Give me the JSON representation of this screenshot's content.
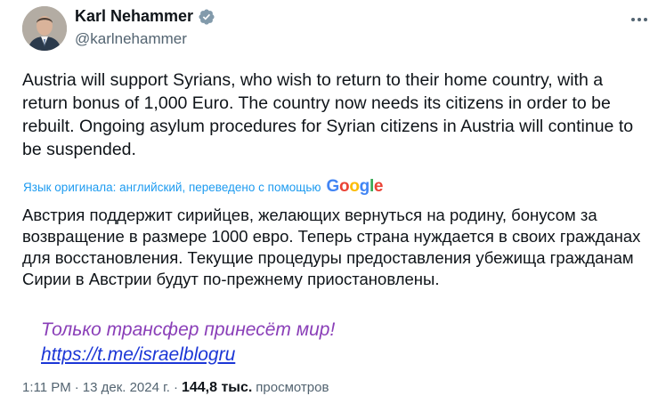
{
  "author": {
    "display_name": "Karl Nehammer",
    "handle": "@karlnehammer",
    "verified_icon": "verified-badge-icon"
  },
  "tweet": {
    "text_en": "Austria will support Syrians, who wish to return to their home country, with a return bonus of 1,000 Euro. The country now needs its citizens in order to be rebuilt. Ongoing asylum procedures for Syrian citizens in Austria will continue to be suspended.",
    "translation_note": "Язык оригинала: английский, переведено с помощью",
    "translation_provider": "Google",
    "text_ru": "Австрия поддержит сирийцев, желающих вернуться на родину, бонусом за возвращение в размере 1000 евро. Теперь страна нуждается в своих гражданах для восстановления. Текущие процедуры предоставления убежища гражданам Сирии в Австрии будут по-прежнему приостановлены.",
    "promo_text": "Только трансфер принесёт мир!",
    "promo_link": "https://t.me/israelblogru"
  },
  "meta": {
    "time": "1:11 PM",
    "sep1": "·",
    "date": "13 дек. 2024 г.",
    "sep2": "·",
    "views_count": "144,8 тыс.",
    "views_label": "просмотров"
  },
  "colors": {
    "text": "#0f1419",
    "secondary": "#536471",
    "link": "#1d9bf0",
    "verified": "#829aab",
    "promo": "#8a3fb8",
    "promo_link": "#1b36d6"
  }
}
